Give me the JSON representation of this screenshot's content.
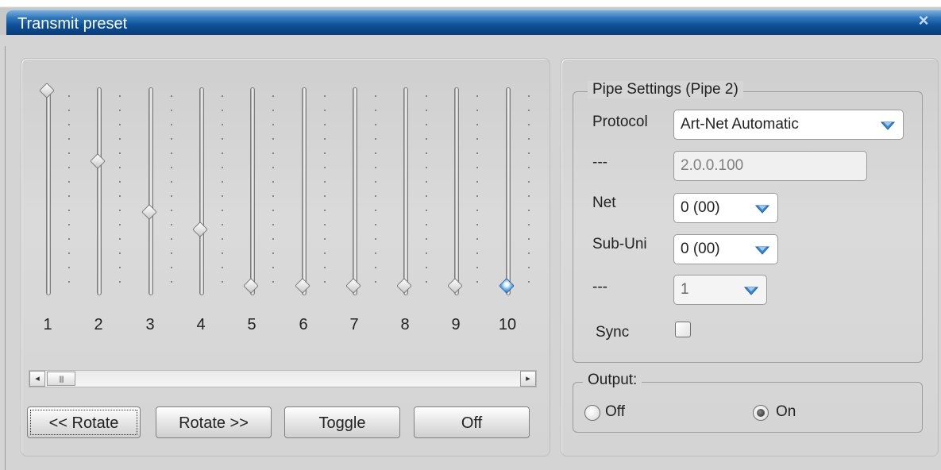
{
  "window": {
    "title": "Transmit preset",
    "close_symbol": "×"
  },
  "sliders": [
    {
      "label": "1",
      "value": 1.0,
      "active": false
    },
    {
      "label": "2",
      "value": 0.64,
      "active": false
    },
    {
      "label": "3",
      "value": 0.38,
      "active": false
    },
    {
      "label": "4",
      "value": 0.29,
      "active": false
    },
    {
      "label": "5",
      "value": 0.0,
      "active": false
    },
    {
      "label": "6",
      "value": 0.0,
      "active": false
    },
    {
      "label": "7",
      "value": 0.0,
      "active": false
    },
    {
      "label": "8",
      "value": 0.0,
      "active": false
    },
    {
      "label": "9",
      "value": 0.0,
      "active": false
    },
    {
      "label": "10",
      "value": 0.0,
      "active": true
    }
  ],
  "scrollbar": {
    "left_arrow": "◂",
    "right_arrow": "▸",
    "thumb_grip": "||||"
  },
  "buttons": {
    "rotate_left": "<< Rotate",
    "rotate_right": "Rotate >>",
    "toggle": "Toggle",
    "off": "Off"
  },
  "pipe_settings": {
    "legend": "Pipe Settings (Pipe 2)",
    "protocol_label": "Protocol",
    "protocol_value": "Art-Net Automatic",
    "address_label": "---",
    "address_value": "2.0.0.100",
    "net_label": "Net",
    "net_value": "0 (00)",
    "subuni_label": "Sub-Uni",
    "subuni_value": "0 (00)",
    "universe_label": "---",
    "universe_value": "1",
    "sync_label": "Sync",
    "sync_checked": false
  },
  "output": {
    "legend": "Output:",
    "off_label": "Off",
    "on_label": "On",
    "selected": "On"
  },
  "colors": {
    "title_blue": "#0d4f96",
    "accent_blue": "#2373c4"
  }
}
